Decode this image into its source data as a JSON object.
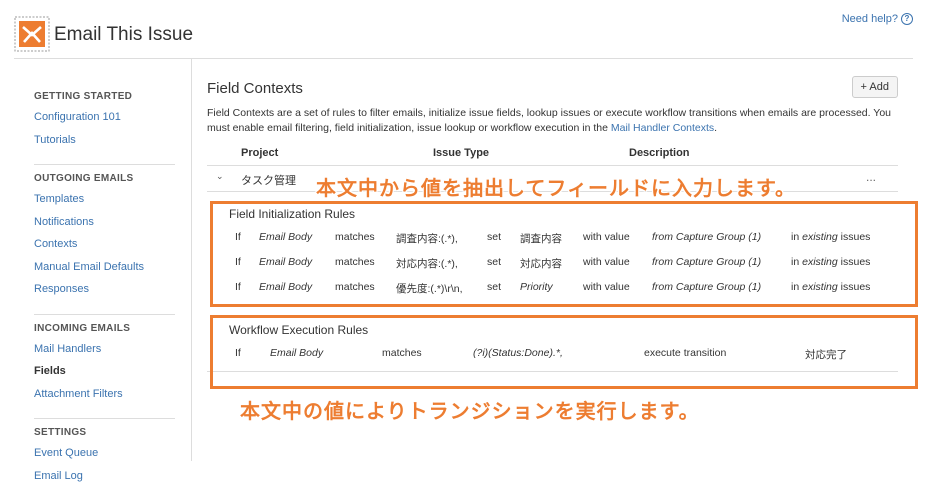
{
  "app": {
    "title": "Email This Issue",
    "help_label": "Need help?"
  },
  "sidebar": {
    "sections": [
      {
        "heading": "GETTING STARTED",
        "items": [
          "Configuration 101",
          "Tutorials"
        ]
      },
      {
        "heading": "OUTGOING EMAILS",
        "items": [
          "Templates",
          "Notifications",
          "Contexts",
          "Manual Email Defaults",
          "Responses"
        ]
      },
      {
        "heading": "INCOMING EMAILS",
        "items": [
          "Mail Handlers",
          "Fields",
          "Attachment Filters"
        ]
      },
      {
        "heading": "SETTINGS",
        "items": [
          "Event Queue",
          "Email Log"
        ]
      }
    ],
    "active_item": "Fields"
  },
  "main": {
    "heading": "Field Contexts",
    "add_label": "Add",
    "intro_text": "Field Contexts are a set of rules to filter emails, initialize issue fields, lookup issues or execute workflow transitions when emails are processed. You must enable email filtering, field initialization, issue lookup or workflow execution in the ",
    "intro_link": "Mail Handler Contexts",
    "intro_end": ".",
    "columns": [
      "Project",
      "Issue Type",
      "Description"
    ],
    "context_row": {
      "project": "タスク管理",
      "menu": "..."
    },
    "field_init": {
      "title": "Field Initialization Rules",
      "rows": [
        {
          "if": "If",
          "source": "Email Body",
          "op": "matches",
          "pattern": "調査内容:(.*),",
          "set": "set",
          "field": "調査内容",
          "with": "with value",
          "from": "from Capture Group (1)",
          "in_pre": "in",
          "in_it": "existing",
          "in_post": "issues"
        },
        {
          "if": "If",
          "source": "Email Body",
          "op": "matches",
          "pattern": "対応内容:(.*),",
          "set": "set",
          "field": "対応内容",
          "with": "with value",
          "from": "from Capture Group (1)",
          "in_pre": "in",
          "in_it": "existing",
          "in_post": "issues"
        },
        {
          "if": "If",
          "source": "Email Body",
          "op": "matches",
          "pattern": "優先度:(.*)\\r\\n,",
          "set": "set",
          "field": "Priority",
          "with": "with value",
          "from": "from Capture Group (1)",
          "in_pre": "in",
          "in_it": "existing",
          "in_post": "issues"
        }
      ]
    },
    "workflow": {
      "title": "Workflow Execution Rules",
      "row": {
        "if": "If",
        "source": "Email Body",
        "op": "matches",
        "pattern": "(?i)(Status:Done).*,",
        "action": "execute transition",
        "target": "対応完了"
      }
    }
  },
  "annotations": {
    "top": "本文中から値を抽出してフィールドに入力します。",
    "bottom": "本文中の値によりトランジションを実行します。",
    "color": "#ed7d31"
  }
}
